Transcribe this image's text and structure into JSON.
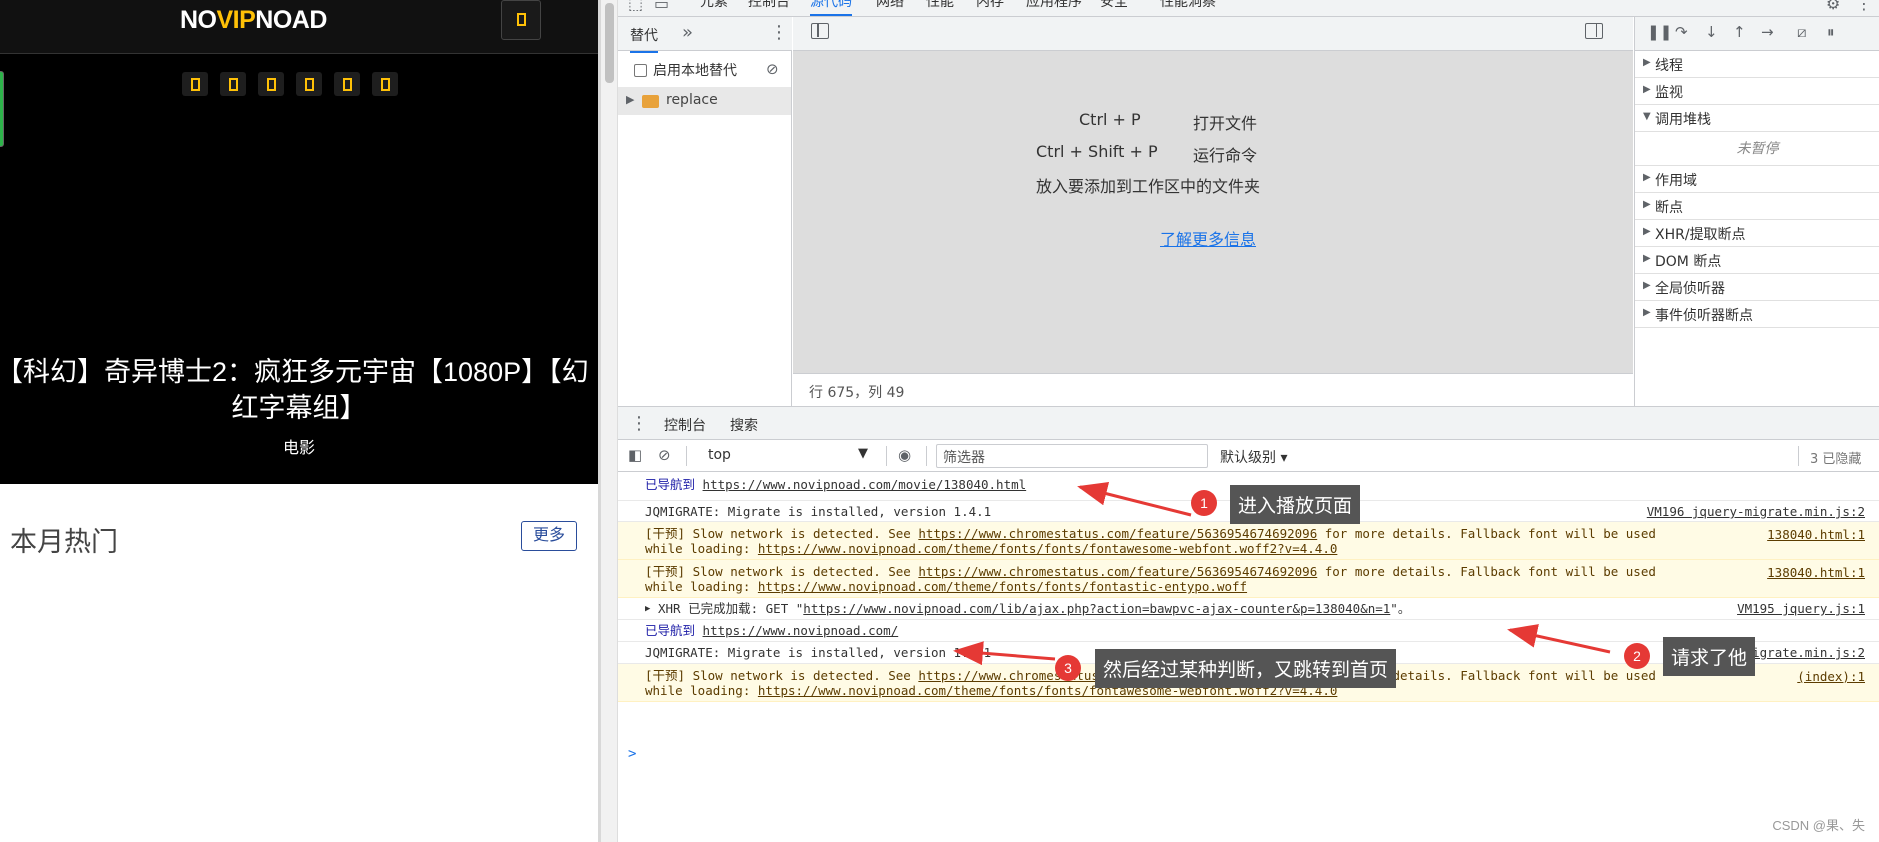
{
  "site": {
    "logo_prefix": "NO",
    "logo_accent": "VIP",
    "logo_suffix": "NOAD",
    "hero_title_line1": "【科幻】奇异博士2：疯狂多元宇宙【1080P】【幻",
    "hero_title_line2": "红字幕组】",
    "hero_category": "电影",
    "section_title": "本月热门",
    "more_label": "更多"
  },
  "devtools": {
    "top_tabs": [
      "元素",
      "控制台",
      "源代码",
      "网络",
      "性能",
      "内存",
      "应用程序",
      "安全",
      "性能洞察"
    ],
    "active_tab": "源代码",
    "navigator": {
      "tab_label": "替代",
      "more_label": "»",
      "enable_local_label": "启用本地替代",
      "folder_label": "replace"
    },
    "editor": {
      "shortcut1_key": "Ctrl + P",
      "shortcut1_action": "打开文件",
      "shortcut2_key": "Ctrl + Shift + P",
      "shortcut2_action": "运行命令",
      "drop_hint": "放入要添加到工作区中的文件夹",
      "learn_more": "了解更多信息",
      "status": "行 675，列 49"
    },
    "debugger": {
      "sections": [
        "线程",
        "监视",
        "调用堆栈",
        "作用域",
        "断点",
        "XHR/提取断点",
        "DOM 断点",
        "全局侦听器",
        "事件侦听器断点"
      ],
      "not_paused": "未暂停"
    },
    "drawer": {
      "tabs": [
        "控制台",
        "搜索"
      ]
    },
    "console_toolbar": {
      "context": "top",
      "filter_placeholder": "筛选器",
      "level": "默认级别",
      "hidden_count": "3 已隐藏"
    },
    "console": {
      "nav1_prefix": "已导航到",
      "nav1_url": "https://www.novipnoad.com/movie/138040.html",
      "jqm1_msg": "JQMIGRATE: Migrate is installed, version 1.4.1",
      "jqm1_src": "VM196 jquery-migrate.min.js:2",
      "warn1_a": "[干预] Slow network is detected. See",
      "warn_link": "https://www.chromestatus.com/feature/5636954674692096",
      "warn1_b": "for more details. Fallback font will be used",
      "warn1_c": "while loading:",
      "warn1_font": "https://www.novipnoad.com/theme/fonts/fonts/fontawesome-webfont.woff2?v=4.4.0",
      "warn1_src": "138040.html:1",
      "warn2_font": "https://www.novipnoad.com/theme/fonts/fonts/fontastic-entypo.woff",
      "warn2_src": "138040.html:1",
      "xhr_prefix": "XHR 已完成加载: GET \"",
      "xhr_url": "https://www.novipnoad.com/lib/ajax.php?action=bawpvc-ajax-counter&p=138040&n=1",
      "xhr_suffix": "\"。",
      "xhr_src": "VM195 jquery.js:1",
      "nav2_prefix": "已导航到",
      "nav2_url": "https://www.novipnoad.com/",
      "jqm2_msg": "JQMIGRATE: Migrate is installed, version 1.4.1",
      "jqm2_src": "jquery-migrate.min.js:2",
      "warn3_src": "(index):1",
      "prompt": ">"
    }
  },
  "annotations": [
    {
      "number": "1",
      "text": "进入播放页面"
    },
    {
      "number": "2",
      "text": "请求了他"
    },
    {
      "number": "3",
      "text": "然后经过某种判断，又跳转到首页"
    }
  ],
  "watermark": "CSDN @果、失",
  "colors": {
    "accent": "#1a73e8",
    "logo_accent": "#ffc107",
    "warning_bg": "#fffbe5",
    "badge_red": "#e53935",
    "callout_bg": "#555555"
  }
}
